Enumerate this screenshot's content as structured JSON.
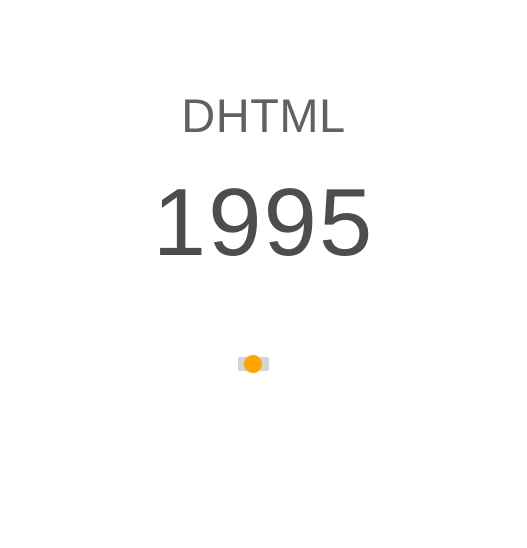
{
  "slide": {
    "technology": "DHTML",
    "year": "1995"
  },
  "pager": {
    "active_index": 1,
    "total": 1,
    "active_color": "#FFA500",
    "track_color": "#D4D4D4"
  }
}
